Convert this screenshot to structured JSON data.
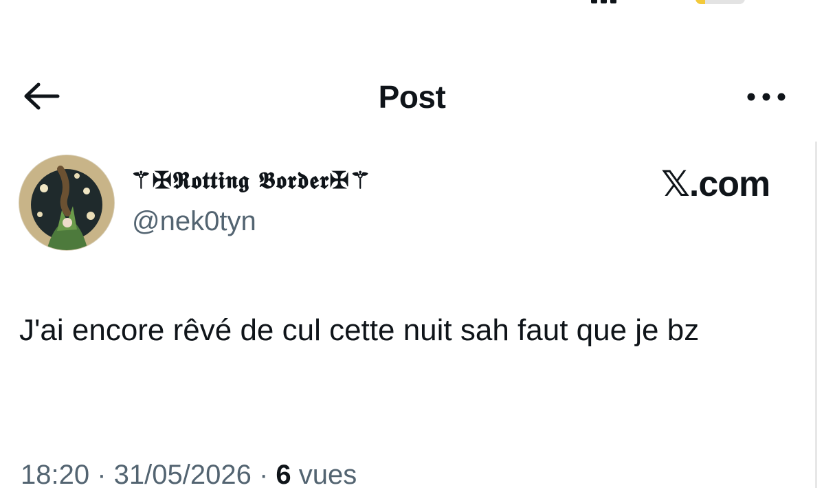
{
  "header": {
    "title": "Post",
    "back_icon": "arrow-left-icon",
    "more_icon": "more-horizontal-icon"
  },
  "author": {
    "display_name": "⚚✠𝕽𝖔𝖙𝖙𝖎𝖓𝖌 𝕭𝖔𝖗𝖉𝖊𝖗✠⚚",
    "handle": "@nek0tyn"
  },
  "source": {
    "label": "𝕏.com"
  },
  "tweet": {
    "text": "J'ai encore rêvé de cul cette nuit sah faut que je bz"
  },
  "meta": {
    "time": "18:20",
    "separator1": " · ",
    "date": "31/05/2026",
    "separator2": " · ",
    "views_count": "6",
    "views_label": " vues"
  },
  "colors": {
    "text_primary": "#0f1419",
    "text_secondary": "#536471",
    "background": "#ffffff"
  }
}
